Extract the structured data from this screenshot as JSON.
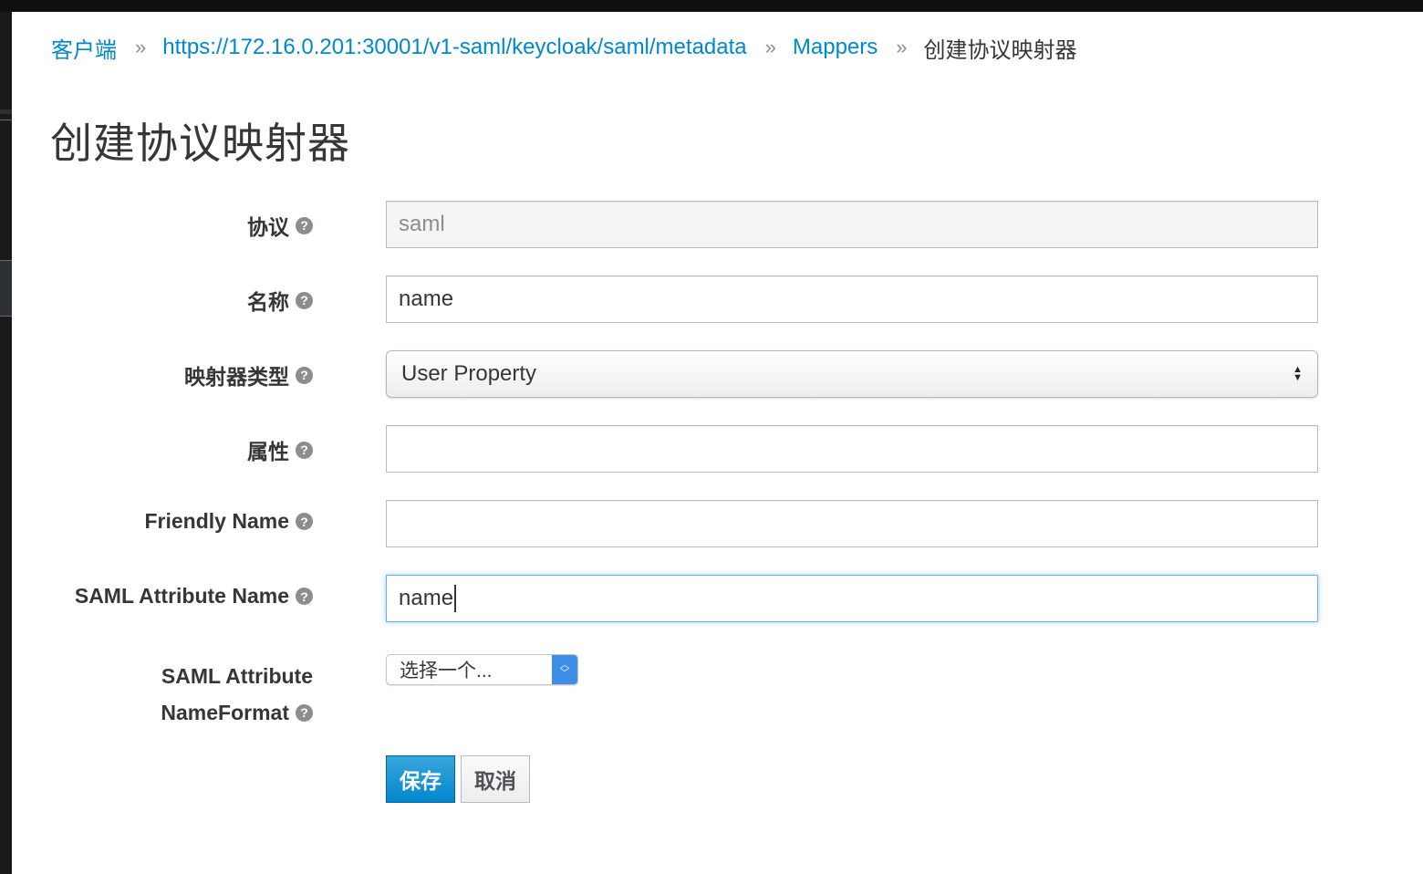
{
  "breadcrumb": {
    "items": [
      "客户端",
      "https://172.16.0.201:30001/v1-saml/keycloak/saml/metadata",
      "Mappers"
    ],
    "current": "创建协议映射器",
    "separator": "»"
  },
  "page_title": "创建协议映射器",
  "form": {
    "protocol": {
      "label": "协议",
      "value": "saml"
    },
    "name": {
      "label": "名称",
      "value": "name"
    },
    "mapper_type": {
      "label": "映射器类型",
      "value": "User Property"
    },
    "property": {
      "label": "属性",
      "value": ""
    },
    "friendly_name": {
      "label": "Friendly Name",
      "value": ""
    },
    "saml_attribute_name": {
      "label": "SAML Attribute Name",
      "value": "name"
    },
    "saml_attribute_nameformat": {
      "label_line1": "SAML Attribute",
      "label_line2": "NameFormat",
      "value": "选择一个..."
    }
  },
  "help_icon": "question-circle-icon",
  "help_glyph": "?",
  "buttons": {
    "save": "保存",
    "cancel": "取消"
  },
  "colors": {
    "link": "#0088ce",
    "primary": "#0088ce",
    "focus": "#66afe9"
  }
}
